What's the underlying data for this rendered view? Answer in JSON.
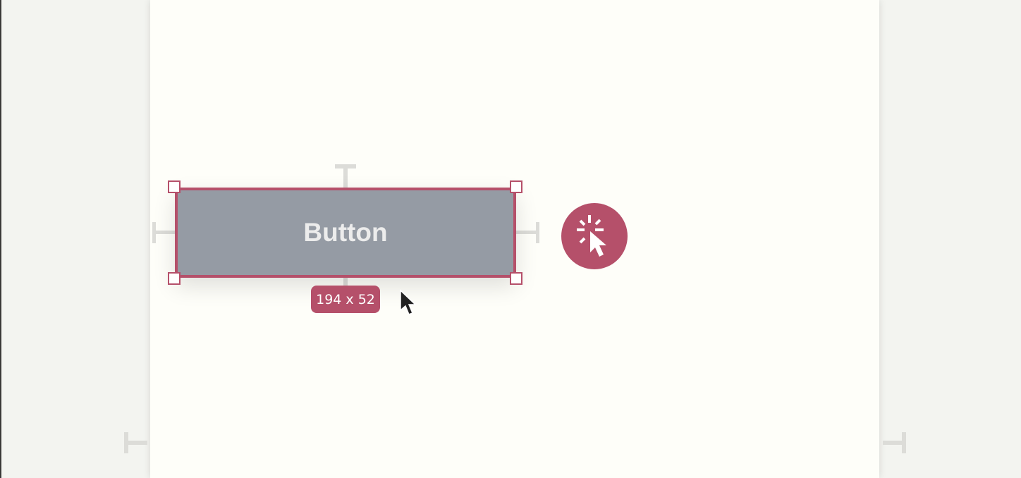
{
  "canvas": {
    "button_label": "Button",
    "size_badge": "194 x 52"
  },
  "colors": {
    "accent": "#b5506a",
    "button_fill": "#959ba4",
    "page": "#fefef9",
    "background": "#f3f4f0"
  },
  "icons": {
    "fab": "click-cursor-icon",
    "pointer": "mouse-pointer-icon"
  }
}
